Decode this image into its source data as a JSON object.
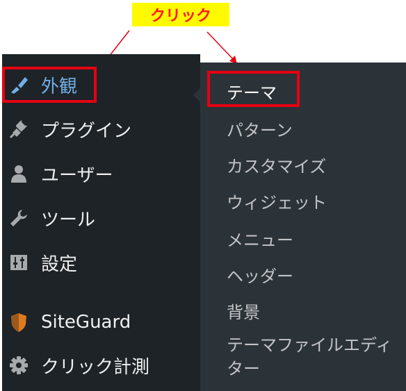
{
  "callout": {
    "text": "クリック",
    "bg": "#fffa00",
    "color": "#ff1a1a"
  },
  "sidebar": {
    "items": [
      {
        "label": "外観",
        "icon": "paintbrush-icon",
        "active": true
      },
      {
        "label": "プラグイン",
        "icon": "plugin-icon"
      },
      {
        "label": "ユーザー",
        "icon": "user-icon"
      },
      {
        "label": "ツール",
        "icon": "wrench-icon"
      },
      {
        "label": "設定",
        "icon": "settings-sliders-icon"
      },
      {
        "label": "SiteGuard",
        "icon": "siteguard-shield-icon"
      },
      {
        "label": "クリック計測",
        "icon": "gear-icon"
      }
    ]
  },
  "submenu": {
    "items": [
      {
        "label": "テーマ",
        "current": true
      },
      {
        "label": "パターン"
      },
      {
        "label": "カスタマイズ"
      },
      {
        "label": "ウィジェット"
      },
      {
        "label": "メニュー"
      },
      {
        "label": "ヘッダー"
      },
      {
        "label": "背景"
      },
      {
        "label": "テーマファイルエディター"
      }
    ]
  },
  "colors": {
    "sidebar_bg": "#1d2327",
    "submenu_bg": "#2c3338",
    "active": "#72aee6",
    "highlight": "#e60012"
  }
}
